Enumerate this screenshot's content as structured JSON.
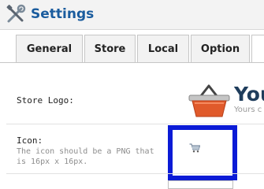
{
  "header": {
    "title": "Settings",
    "icon": "tools-icon"
  },
  "tabs": [
    {
      "label": "General"
    },
    {
      "label": "Store"
    },
    {
      "label": "Local"
    },
    {
      "label": "Option"
    }
  ],
  "fields": {
    "store_logo": {
      "label": "Store Logo:",
      "logo_title": "You",
      "logo_tagline": "Yours c"
    },
    "icon": {
      "label": "Icon:",
      "help": "The icon should be a PNG that is 16px x 16px.",
      "icon_name": "shopping-cart-icon"
    }
  },
  "colors": {
    "title": "#1a5c9e",
    "highlight_border": "#0b1bd6",
    "basket": "#e05a2b"
  }
}
